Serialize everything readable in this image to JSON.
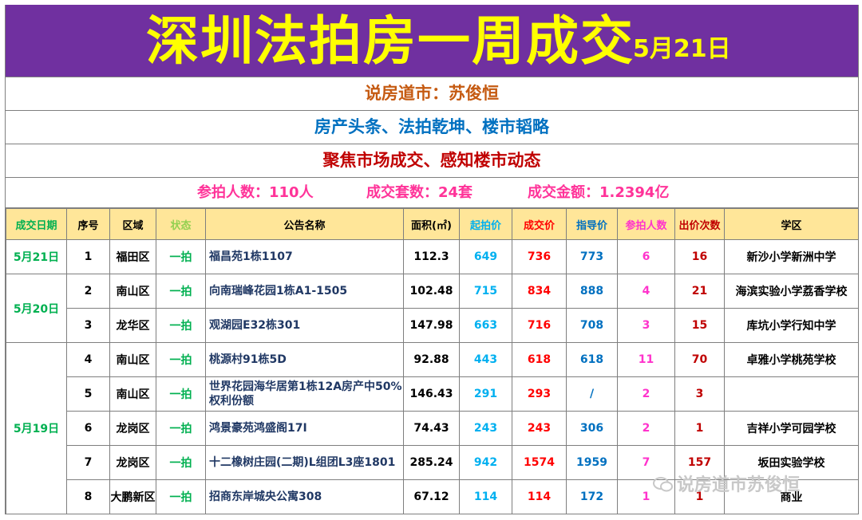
{
  "banner": {
    "title": "深圳法拍房一周成交",
    "date": "5月21日"
  },
  "author": "说房道市：苏俊恒",
  "slogan1": "房产头条、法拍乾坤、楼市韬略",
  "slogan2": "聚焦市场成交、感知楼市动态",
  "stats": {
    "participants": "参拍人数：110人",
    "deals": "成交套数：24套",
    "amount": "成交金额：1.2394亿"
  },
  "headers": {
    "date": "成交日期",
    "no": "序号",
    "district": "区域",
    "status": "状态",
    "name": "公告名称",
    "area": "面积(㎡)",
    "start": "起拍价",
    "deal": "成交价",
    "guide": "指导价",
    "bidders": "参拍人数",
    "bids": "出价次数",
    "school": "学区"
  },
  "groups": [
    {
      "date": "5月21日",
      "rows": [
        {
          "no": "1",
          "district": "福田区",
          "status": "一拍",
          "name": "福昌苑1栋1107",
          "area": "112.3",
          "start": "649",
          "deal": "736",
          "guide": "773",
          "bidders": "6",
          "bids": "16",
          "school": "新沙小学新洲中学"
        }
      ]
    },
    {
      "date": "5月20日",
      "rows": [
        {
          "no": "2",
          "district": "南山区",
          "status": "一拍",
          "name": "向南瑞峰花园1栋A1-1505",
          "area": "102.48",
          "start": "715",
          "deal": "834",
          "guide": "888",
          "bidders": "4",
          "bids": "21",
          "school": "海滨实验小学荔香学校"
        },
        {
          "no": "3",
          "district": "龙华区",
          "status": "一拍",
          "name": "观湖园E32栋301",
          "area": "147.98",
          "start": "663",
          "deal": "716",
          "guide": "708",
          "bidders": "3",
          "bids": "15",
          "school": "库坑小学行知中学"
        }
      ]
    },
    {
      "date": "5月19日",
      "rows": [
        {
          "no": "4",
          "district": "南山区",
          "status": "一拍",
          "name": "桃源村91栋5D",
          "area": "92.88",
          "start": "443",
          "deal": "618",
          "guide": "618",
          "bidders": "11",
          "bids": "70",
          "school": "卓雅小学桃苑学校"
        },
        {
          "no": "5",
          "district": "南山区",
          "status": "一拍",
          "name": "世界花园海华居第1栋12A房产中50%权利份额",
          "area": "146.43",
          "start": "291",
          "deal": "293",
          "guide": "/",
          "bidders": "2",
          "bids": "3",
          "school": ""
        },
        {
          "no": "6",
          "district": "龙岗区",
          "status": "一拍",
          "name": "鸿景豪苑鸿盛阁17I",
          "area": "74.43",
          "start": "243",
          "deal": "243",
          "guide": "306",
          "bidders": "2",
          "bids": "1",
          "school": "吉祥小学可园学校"
        },
        {
          "no": "7",
          "district": "龙岗区",
          "status": "一拍",
          "name": "十二橡树庄园(二期)L组团L3座1801",
          "area": "285.24",
          "start": "942",
          "deal": "1574",
          "guide": "1959",
          "bidders": "7",
          "bids": "157",
          "school": "坂田实验学校"
        },
        {
          "no": "8",
          "district": "大鹏新区",
          "status": "一拍",
          "name": "招商东岸城央公寓308",
          "area": "67.12",
          "start": "114",
          "deal": "114",
          "guide": "172",
          "bidders": "1",
          "bids": "1",
          "school": "商业"
        }
      ]
    }
  ],
  "watermark": "说房道市苏俊恒"
}
